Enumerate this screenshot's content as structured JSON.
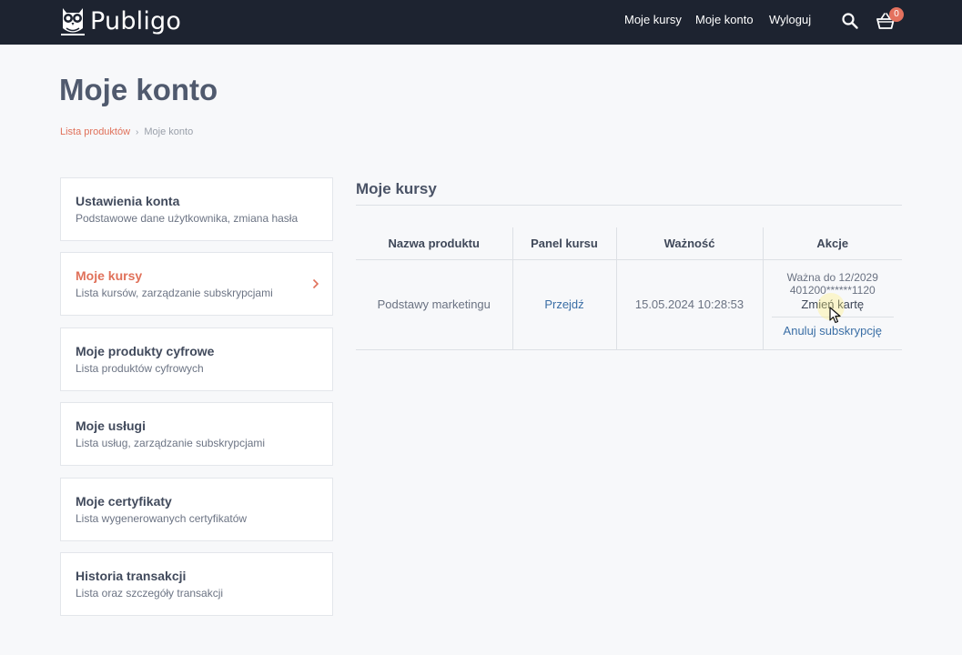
{
  "header": {
    "logo_text": "Publigo",
    "nav": [
      "Moje kursy",
      "Moje konto",
      "Wyloguj"
    ],
    "cart_count": "0",
    "colors": {
      "bar": "#1d2330",
      "badge": "#e4715e"
    }
  },
  "page": {
    "title": "Moje konto",
    "breadcrumb": {
      "link": "Lista produktów",
      "current": "Moje konto"
    }
  },
  "sidebar": {
    "items": [
      {
        "title": "Ustawienia konta",
        "subtitle": "Podstawowe dane użytkownika, zmiana hasła"
      },
      {
        "title": "Moje kursy",
        "subtitle": "Lista kursów, zarządzanie subskrypcjami",
        "active": true
      },
      {
        "title": "Moje produkty cyfrowe",
        "subtitle": "Lista produktów cyfrowych"
      },
      {
        "title": "Moje usługi",
        "subtitle": "Lista usług, zarządzanie subskrypcjami"
      },
      {
        "title": "Moje certyfikaty",
        "subtitle": "Lista wygenerowanych certyfikatów"
      },
      {
        "title": "Historia transakcji",
        "subtitle": "Lista oraz szczegóły transakcji"
      }
    ]
  },
  "main": {
    "section_title": "Moje kursy",
    "table": {
      "headers": [
        "Nazwa produktu",
        "Panel kursu",
        "Ważność",
        "Akcje"
      ],
      "rows": [
        {
          "product": "Podstawy marketingu",
          "panel_link": "Przejdź",
          "validity": "15.05.2024 10:28:53",
          "actions": {
            "valid_until": "Ważna do 12/2029",
            "card": "401200******1120",
            "change_card": "Zmień kartę",
            "cancel": "Anuluj subskrypcję"
          }
        }
      ]
    }
  },
  "accent_color": "#e0715a",
  "link_color": "#3a6ea5"
}
